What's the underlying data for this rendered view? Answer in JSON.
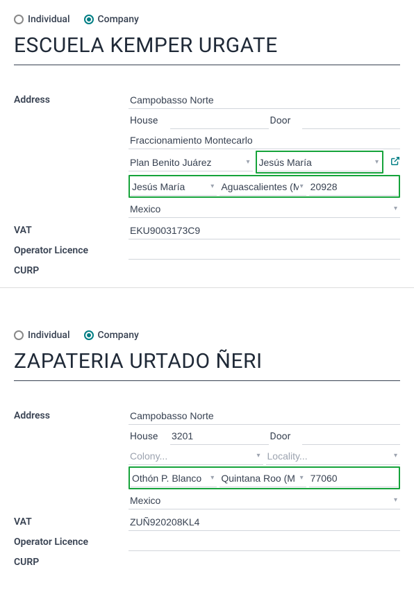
{
  "contact1": {
    "type_individual": "Individual",
    "type_company": "Company",
    "name": "ESCUELA KEMPER URGATE",
    "labels": {
      "address": "Address",
      "vat": "VAT",
      "operator_licence": "Operator Licence",
      "curp": "CURP"
    },
    "street": "Campobasso Norte",
    "house_label": "House",
    "house_value": "",
    "door_label": "Door",
    "door_value": "",
    "street2": "Fraccionamiento Montecarlo",
    "colony": "Plan Benito Juárez",
    "locality": "Jesús María",
    "city": "Jesús María",
    "state": "Aguascalientes (M",
    "zip": "20928",
    "country": "Mexico",
    "vat": "EKU9003173C9",
    "operator_licence": "",
    "curp": ""
  },
  "contact2": {
    "type_individual": "Individual",
    "type_company": "Company",
    "name": "ZAPATERIA URTADO ÑERI",
    "labels": {
      "address": "Address",
      "vat": "VAT",
      "operator_licence": "Operator Licence",
      "curp": "CURP"
    },
    "street": "Campobasso Norte",
    "house_label": "House",
    "house_value": "3201",
    "door_label": "Door",
    "door_value": "",
    "colony_placeholder": "Colony...",
    "locality_placeholder": "Locality...",
    "city": "Othón P. Blanco",
    "state": "Quintana Roo (M",
    "zip": "77060",
    "country": "Mexico",
    "vat": "ZUÑ920208KL4",
    "operator_licence": "",
    "curp": ""
  }
}
